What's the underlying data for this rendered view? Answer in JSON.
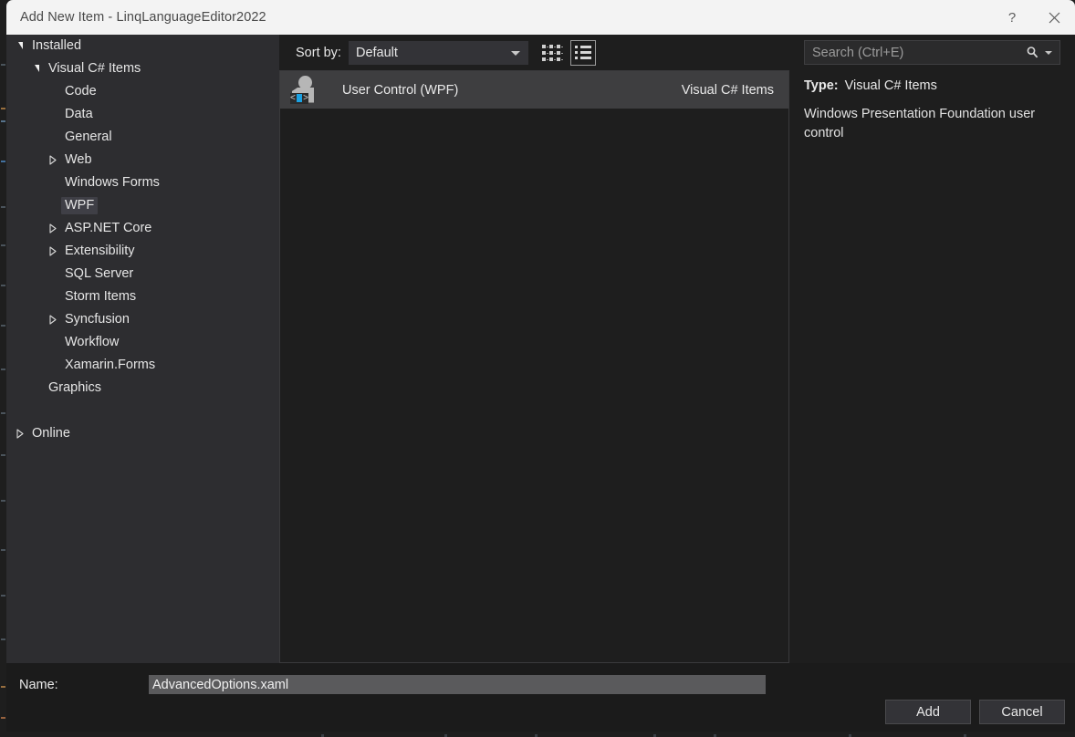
{
  "window": {
    "title": "Add New Item - LinqLanguageEditor2022",
    "help_label": "?",
    "close_label": "×"
  },
  "left_panel": {
    "tree": [
      {
        "label": "Installed",
        "level": 0,
        "twisty": "expanded",
        "selected": false
      },
      {
        "label": "Visual C# Items",
        "level": 1,
        "twisty": "expanded",
        "selected": false
      },
      {
        "label": "Code",
        "level": 2,
        "twisty": "none",
        "selected": false
      },
      {
        "label": "Data",
        "level": 2,
        "twisty": "none",
        "selected": false
      },
      {
        "label": "General",
        "level": 2,
        "twisty": "none",
        "selected": false
      },
      {
        "label": "Web",
        "level": 2,
        "twisty": "collapsed",
        "selected": false
      },
      {
        "label": "Windows Forms",
        "level": 2,
        "twisty": "none",
        "selected": false
      },
      {
        "label": "WPF",
        "level": 2,
        "twisty": "none",
        "selected": true
      },
      {
        "label": "ASP.NET Core",
        "level": 2,
        "twisty": "collapsed",
        "selected": false
      },
      {
        "label": "Extensibility",
        "level": 2,
        "twisty": "collapsed",
        "selected": false
      },
      {
        "label": "SQL Server",
        "level": 2,
        "twisty": "none",
        "selected": false
      },
      {
        "label": "Storm Items",
        "level": 2,
        "twisty": "none",
        "selected": false
      },
      {
        "label": "Syncfusion",
        "level": 2,
        "twisty": "collapsed",
        "selected": false
      },
      {
        "label": "Workflow",
        "level": 2,
        "twisty": "none",
        "selected": false
      },
      {
        "label": "Xamarin.Forms",
        "level": 2,
        "twisty": "none",
        "selected": false
      },
      {
        "label": "Graphics",
        "level": 1,
        "twisty": "none",
        "selected": false
      },
      {
        "label": "",
        "level": 0,
        "twisty": "none",
        "selected": false
      },
      {
        "label": "Online",
        "level": 0,
        "twisty": "collapsed",
        "selected": false
      }
    ]
  },
  "toolbar": {
    "sort_by_label": "Sort by:",
    "sort_by_value": "Default",
    "tiles_view_icon": "tiles-view-icon",
    "list_view_icon": "list-view-icon",
    "active_view": "list"
  },
  "item_list": {
    "items": [
      {
        "name": "User Control (WPF)",
        "category": "Visual C# Items",
        "icon": "user-control-wpf-icon",
        "selected": true
      }
    ]
  },
  "search": {
    "placeholder": "Search (Ctrl+E)",
    "icon": "search-icon"
  },
  "details": {
    "type_key": "Type:",
    "type_value": "Visual C# Items",
    "description": "Windows Presentation Foundation user control"
  },
  "footer": {
    "name_label": "Name:",
    "name_value": "AdvancedOptions.xaml",
    "add_label": "Add",
    "cancel_label": "Cancel"
  },
  "colors": {
    "titlebar_bg": "#f3f3f3",
    "tree_bg": "#2d2d30",
    "list_bg": "#1e1e1e",
    "selection_bg": "#3e3e40",
    "accent_blue": "#1ba1e2"
  }
}
